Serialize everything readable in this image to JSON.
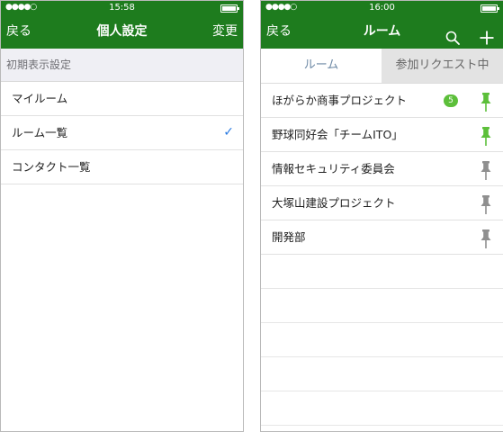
{
  "left": {
    "status": {
      "signal": "●●●●○",
      "time": "15:58"
    },
    "nav": {
      "back": "戻る",
      "title": "個人設定",
      "action": "変更"
    },
    "section": "初期表示設定",
    "options": [
      {
        "label": "マイルーム",
        "selected": false
      },
      {
        "label": "ルーム一覧",
        "selected": true
      },
      {
        "label": "コンタクト一覧",
        "selected": false
      }
    ],
    "check_mark": "✓"
  },
  "right": {
    "status": {
      "signal": "●●●●○",
      "time": "16:00"
    },
    "nav": {
      "back": "戻る",
      "title": "ルーム",
      "search_icon": "search-icon",
      "add_icon": "plus-icon"
    },
    "tabs": {
      "room": "ルーム",
      "requests": "参加リクエスト中"
    },
    "rooms": [
      {
        "name": "ほがらか商事プロジェクト",
        "badge": "5",
        "pinned": true
      },
      {
        "name": "野球同好会「チームITO」",
        "badge": "",
        "pinned": true
      },
      {
        "name": "情報セキュリティ委員会",
        "badge": "",
        "pinned": false
      },
      {
        "name": "大塚山建設プロジェクト",
        "badge": "",
        "pinned": false
      },
      {
        "name": "開発部",
        "badge": "",
        "pinned": false
      }
    ]
  },
  "colors": {
    "header_green": "#1e7c1e",
    "pin_active": "#5cbf3a",
    "pin_inactive": "#8f8f8f",
    "badge": "#5cbf3a",
    "check": "#2a7ae2"
  }
}
